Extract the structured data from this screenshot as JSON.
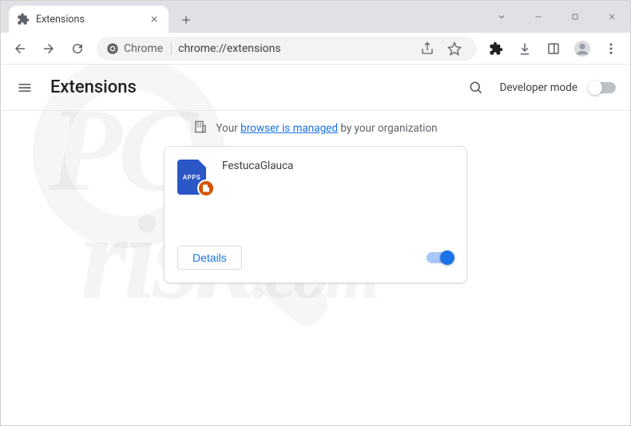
{
  "window": {
    "tab_title": "Extensions"
  },
  "omnibox": {
    "chip_label": "Chrome",
    "url": "chrome://extensions"
  },
  "header": {
    "title": "Extensions",
    "devmode_label": "Developer mode",
    "devmode_on": false
  },
  "banner": {
    "prefix": "Your ",
    "link_text": "browser is managed",
    "suffix": " by your organization"
  },
  "extension": {
    "name": "FestucaGlauca",
    "icon_label": "APPS",
    "details_label": "Details",
    "enabled": true
  },
  "watermark": {
    "line1": "PC",
    "line2": "risk",
    "line3": ".com"
  }
}
